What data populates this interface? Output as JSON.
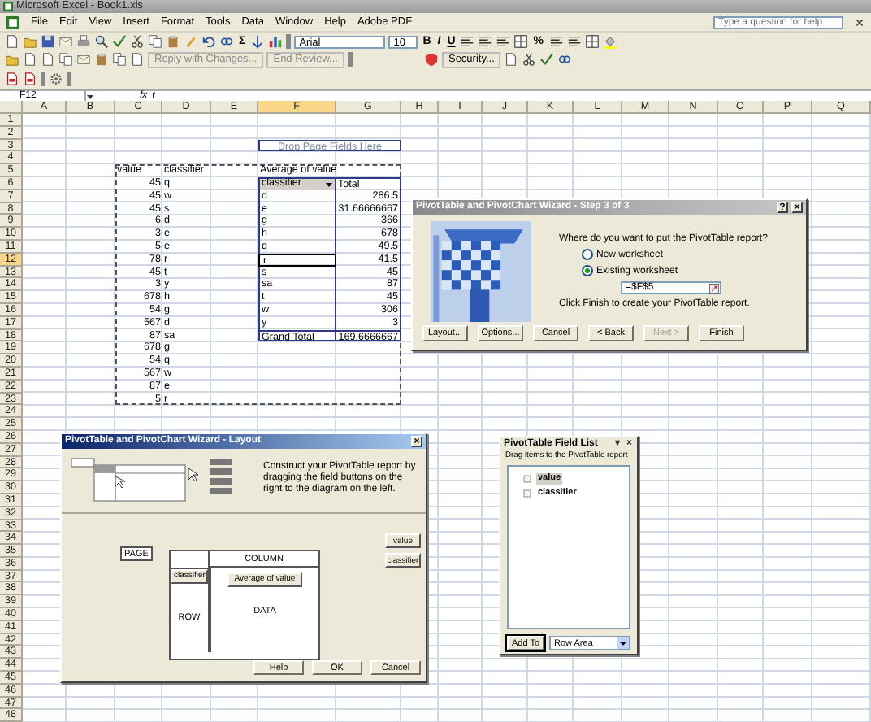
{
  "window": {
    "title": "Microsoft Excel - Book1.xls"
  },
  "menu": {
    "items": [
      "File",
      "Edit",
      "View",
      "Insert",
      "Format",
      "Tools",
      "Data",
      "Window",
      "Help",
      "Adobe PDF"
    ],
    "help_box": {
      "placeholder": "Type a question for help"
    }
  },
  "toolbar": {
    "sum": "Σ",
    "font": "Arial",
    "font_size": "10",
    "bold": "B",
    "italic": "I",
    "underline": "U",
    "percent": "%"
  },
  "reviewing_toolbar": {
    "reply": "Reply with Changes...",
    "end_review": "End Review...",
    "security": "Security..."
  },
  "formula_bar": {
    "name_box": "F12",
    "fx": "fx",
    "value": "r"
  },
  "sheet": {
    "columns": [
      {
        "label": "A",
        "selected": false
      },
      {
        "label": "B",
        "selected": false
      },
      {
        "label": "C",
        "selected": false
      },
      {
        "label": "D",
        "selected": false
      },
      {
        "label": "E",
        "selected": false
      },
      {
        "label": "F",
        "selected": true
      },
      {
        "label": "G",
        "selected": false
      },
      {
        "label": "H",
        "selected": false
      },
      {
        "label": "I",
        "selected": false
      },
      {
        "label": "J",
        "selected": false
      },
      {
        "label": "K",
        "selected": false
      },
      {
        "label": "L",
        "selected": false
      },
      {
        "label": "M",
        "selected": false
      },
      {
        "label": "N",
        "selected": false
      },
      {
        "label": "O",
        "selected": false
      },
      {
        "label": "P",
        "selected": false
      },
      {
        "label": "Q",
        "selected": false
      }
    ],
    "copy_marquee": true,
    "rows": [
      {
        "label": "1",
        "selected": false
      },
      {
        "label": "2",
        "selected": false
      },
      {
        "label": "3",
        "selected": false,
        "cells": {
          "F": {
            "kind": "pivot-drop-zone",
            "text": "Drop Page Fields Here",
            "selected": false
          }
        }
      },
      {
        "label": "4",
        "selected": false
      },
      {
        "label": "5",
        "selected": false,
        "cells": {
          "C": {
            "kind": "text",
            "text": "value",
            "selected": false
          },
          "D": {
            "kind": "text",
            "text": "classifier",
            "selected": false
          },
          "F": {
            "kind": "pivot-caption",
            "text": "Average of value",
            "selected": false
          }
        }
      },
      {
        "label": "6",
        "selected": false,
        "cells": {
          "C": {
            "kind": "number",
            "text": "45",
            "selected": false
          },
          "D": {
            "kind": "text",
            "text": "q",
            "selected": false
          },
          "F": {
            "kind": "pivot-field",
            "text": "classifier",
            "selected": false
          },
          "G": {
            "kind": "pivot-header",
            "text": "Total",
            "selected": false
          }
        }
      },
      {
        "label": "7",
        "selected": false,
        "cells": {
          "C": {
            "kind": "number",
            "text": "45",
            "selected": false
          },
          "D": {
            "kind": "text",
            "text": "w",
            "selected": false
          },
          "F": {
            "kind": "pivot-item",
            "text": "d",
            "selected": false
          },
          "G": {
            "kind": "pivot-value",
            "text": "286.5",
            "selected": false
          }
        }
      },
      {
        "label": "8",
        "selected": false,
        "cells": {
          "C": {
            "kind": "number",
            "text": "45",
            "selected": false
          },
          "D": {
            "kind": "text",
            "text": "s",
            "selected": false
          },
          "F": {
            "kind": "pivot-item",
            "text": "e",
            "selected": false
          },
          "G": {
            "kind": "pivot-value",
            "text": "31.66666667",
            "selected": false
          }
        }
      },
      {
        "label": "9",
        "selected": false,
        "cells": {
          "C": {
            "kind": "number",
            "text": "6",
            "selected": false
          },
          "D": {
            "kind": "text",
            "text": "d",
            "selected": false
          },
          "F": {
            "kind": "pivot-item",
            "text": "g",
            "selected": false
          },
          "G": {
            "kind": "pivot-value",
            "text": "366",
            "selected": false
          }
        }
      },
      {
        "label": "10",
        "selected": false,
        "cells": {
          "C": {
            "kind": "number",
            "text": "3",
            "selected": false
          },
          "D": {
            "kind": "text",
            "text": "e",
            "selected": false
          },
          "F": {
            "kind": "pivot-item",
            "text": "h",
            "selected": false
          },
          "G": {
            "kind": "pivot-value",
            "text": "678",
            "selected": false
          }
        }
      },
      {
        "label": "11",
        "selected": false,
        "cells": {
          "C": {
            "kind": "number",
            "text": "5",
            "selected": false
          },
          "D": {
            "kind": "text",
            "text": "e",
            "selected": false
          },
          "F": {
            "kind": "pivot-item",
            "text": "q",
            "selected": false
          },
          "G": {
            "kind": "pivot-value",
            "text": "49.5",
            "selected": false
          }
        }
      },
      {
        "label": "12",
        "selected": true,
        "cells": {
          "C": {
            "kind": "number",
            "text": "78",
            "selected": false
          },
          "D": {
            "kind": "text",
            "text": "r",
            "selected": false
          },
          "F": {
            "kind": "pivot-item",
            "text": "r",
            "selected": true
          },
          "G": {
            "kind": "pivot-value",
            "text": "41.5",
            "selected": false
          }
        }
      },
      {
        "label": "13",
        "selected": false,
        "cells": {
          "C": {
            "kind": "number",
            "text": "45",
            "selected": false
          },
          "D": {
            "kind": "text",
            "text": "t",
            "selected": false
          },
          "F": {
            "kind": "pivot-item",
            "text": "s",
            "selected": false
          },
          "G": {
            "kind": "pivot-value",
            "text": "45",
            "selected": false
          }
        }
      },
      {
        "label": "14",
        "selected": false,
        "cells": {
          "C": {
            "kind": "number",
            "text": "3",
            "selected": false
          },
          "D": {
            "kind": "text",
            "text": "y",
            "selected": false
          },
          "F": {
            "kind": "pivot-item",
            "text": "sa",
            "selected": false
          },
          "G": {
            "kind": "pivot-value",
            "text": "87",
            "selected": false
          }
        }
      },
      {
        "label": "15",
        "selected": false,
        "cells": {
          "C": {
            "kind": "number",
            "text": "678",
            "selected": false
          },
          "D": {
            "kind": "text",
            "text": "h",
            "selected": false
          },
          "F": {
            "kind": "pivot-item",
            "text": "t",
            "selected": false
          },
          "G": {
            "kind": "pivot-value",
            "text": "45",
            "selected": false
          }
        }
      },
      {
        "label": "16",
        "selected": false,
        "cells": {
          "C": {
            "kind": "number",
            "text": "54",
            "selected": false
          },
          "D": {
            "kind": "text",
            "text": "g",
            "selected": false
          },
          "F": {
            "kind": "pivot-item",
            "text": "w",
            "selected": false
          },
          "G": {
            "kind": "pivot-value",
            "text": "306",
            "selected": false
          }
        }
      },
      {
        "label": "17",
        "selected": false,
        "cells": {
          "C": {
            "kind": "number",
            "text": "567",
            "selected": false
          },
          "D": {
            "kind": "text",
            "text": "d",
            "selected": false
          },
          "F": {
            "kind": "pivot-item",
            "text": "y",
            "selected": false
          },
          "G": {
            "kind": "pivot-value",
            "text": "3",
            "selected": false
          }
        }
      },
      {
        "label": "18",
        "selected": false,
        "cells": {
          "C": {
            "kind": "number",
            "text": "87",
            "selected": false
          },
          "D": {
            "kind": "text",
            "text": "sa",
            "selected": false
          },
          "F": {
            "kind": "pivot-grand-label",
            "text": "Grand Total",
            "selected": false
          },
          "G": {
            "kind": "pivot-grand-value",
            "text": "169.6666667",
            "selected": false
          }
        }
      },
      {
        "label": "19",
        "selected": false,
        "cells": {
          "C": {
            "kind": "number",
            "text": "678",
            "selected": false
          },
          "D": {
            "kind": "text",
            "text": "g",
            "selected": false
          }
        }
      },
      {
        "label": "20",
        "selected": false,
        "cells": {
          "C": {
            "kind": "number",
            "text": "54",
            "selected": false
          },
          "D": {
            "kind": "text",
            "text": "q",
            "selected": false
          }
        }
      },
      {
        "label": "21",
        "selected": false,
        "cells": {
          "C": {
            "kind": "number",
            "text": "567",
            "selected": false
          },
          "D": {
            "kind": "text",
            "text": "w",
            "selected": false
          }
        }
      },
      {
        "label": "22",
        "selected": false,
        "cells": {
          "C": {
            "kind": "number",
            "text": "87",
            "selected": false
          },
          "D": {
            "kind": "text",
            "text": "e",
            "selected": false
          }
        }
      },
      {
        "label": "23",
        "selected": false,
        "cells": {
          "C": {
            "kind": "number",
            "text": "5",
            "selected": false
          },
          "D": {
            "kind": "text",
            "text": "r",
            "selected": false
          }
        }
      },
      {
        "label": "24",
        "selected": false
      },
      {
        "label": "25",
        "selected": false
      },
      {
        "label": "26",
        "selected": false
      },
      {
        "label": "27",
        "selected": false
      },
      {
        "label": "28",
        "selected": false
      },
      {
        "label": "29",
        "selected": false
      },
      {
        "label": "30",
        "selected": false
      },
      {
        "label": "31",
        "selected": false
      },
      {
        "label": "32",
        "selected": false
      },
      {
        "label": "33",
        "selected": false
      },
      {
        "label": "34",
        "selected": false
      },
      {
        "label": "35",
        "selected": false
      },
      {
        "label": "36",
        "selected": false
      },
      {
        "label": "37",
        "selected": false
      },
      {
        "label": "38",
        "selected": false
      },
      {
        "label": "39",
        "selected": false
      },
      {
        "label": "40",
        "selected": false
      },
      {
        "label": "41",
        "selected": false
      },
      {
        "label": "42",
        "selected": false
      },
      {
        "label": "43",
        "selected": false
      },
      {
        "label": "44",
        "selected": false
      },
      {
        "label": "45",
        "selected": false
      },
      {
        "label": "46",
        "selected": false
      },
      {
        "label": "47",
        "selected": false
      },
      {
        "label": "48",
        "selected": false
      }
    ]
  },
  "wizard_step3": {
    "title": "PivotTable and PivotChart Wizard - Step 3 of 3",
    "title_buttons": [
      "?",
      "×"
    ],
    "question": "Where do you want to put the PivotTable report?",
    "options": [
      {
        "label": "New worksheet",
        "selected": false
      },
      {
        "label": "Existing worksheet",
        "selected": true
      }
    ],
    "location": "=$F$5",
    "hint": "Click Finish to create your PivotTable report.",
    "buttons": [
      {
        "label": "Layout...",
        "disabled": false
      },
      {
        "label": "Options...",
        "disabled": false
      },
      {
        "label": "Cancel",
        "disabled": false
      },
      {
        "label": "< Back",
        "disabled": false
      },
      {
        "label": "Next >",
        "disabled": true
      },
      {
        "label": "Finish",
        "disabled": false
      }
    ]
  },
  "layout_dialog": {
    "title": "PivotTable and PivotChart Wizard - Layout",
    "close": "×",
    "instructions": "Construct your PivotTable report by dragging the field buttons on the right to the diagram on the left.",
    "page": "PAGE",
    "column": "COLUMN",
    "row": "ROW",
    "data": "DATA",
    "row_field": "classifier",
    "data_field": "Average of value",
    "fields": [
      "value",
      "classifier"
    ],
    "buttons": [
      "Help",
      "OK",
      "Cancel"
    ]
  },
  "field_list": {
    "title": "PivotTable Field List",
    "title_buttons": [
      "▾",
      "×"
    ],
    "instructions": "Drag items to the PivotTable report",
    "fields": [
      {
        "label": "value",
        "selected": true
      },
      {
        "label": "classifier",
        "selected": false
      }
    ],
    "add_button": "Add To",
    "area": "Row Area"
  }
}
